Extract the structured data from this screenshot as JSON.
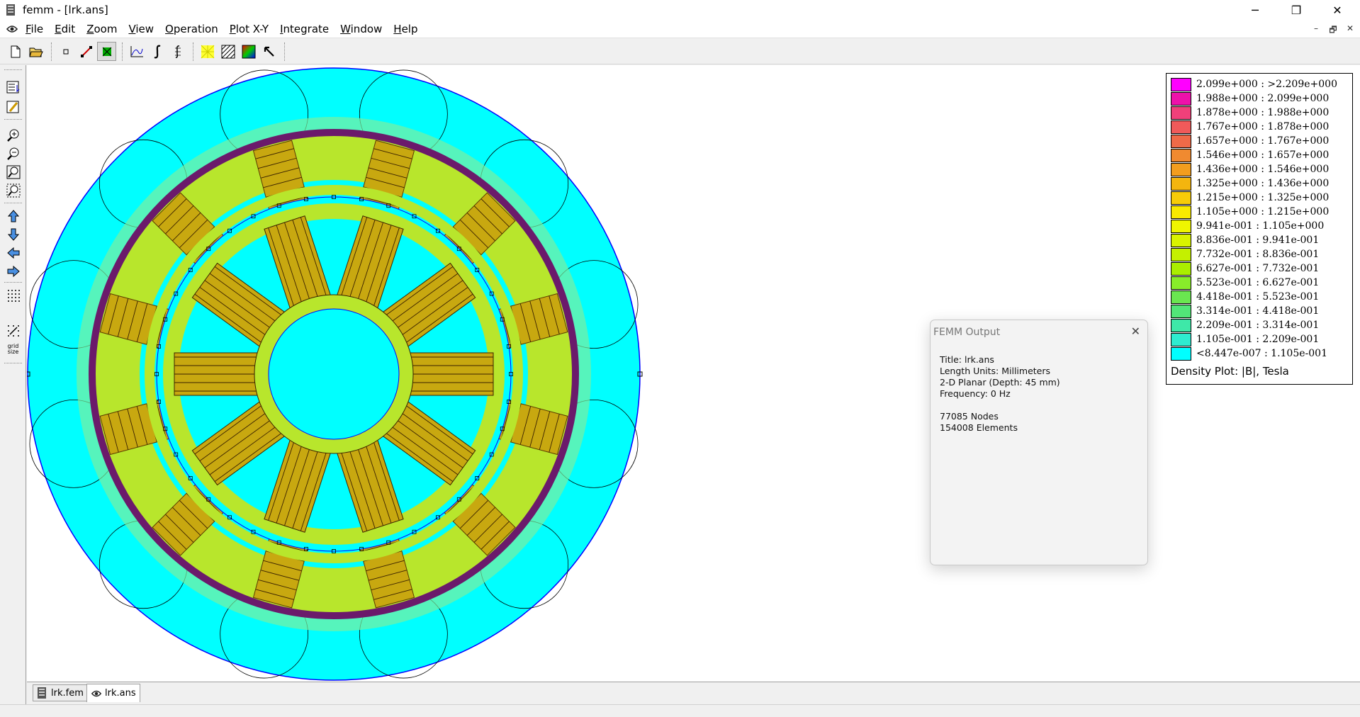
{
  "window": {
    "title": "femm - [lrk.ans]",
    "controls": {
      "minimize": "─",
      "maximize": "❐",
      "close": "✕"
    }
  },
  "menu": {
    "items": [
      {
        "label": "File",
        "u": "F",
        "rest": "ile"
      },
      {
        "label": "Edit",
        "u": "E",
        "rest": "dit"
      },
      {
        "label": "Zoom",
        "u": "Z",
        "rest": "oom"
      },
      {
        "label": "View",
        "u": "V",
        "rest": "iew"
      },
      {
        "label": "Operation",
        "u": "O",
        "rest": "peration"
      },
      {
        "label": "Plot X-Y",
        "u": "P",
        "rest": "lot X-Y"
      },
      {
        "label": "Integrate",
        "u": "I",
        "rest": "ntegrate"
      },
      {
        "label": "Window",
        "u": "W",
        "rest": "indow"
      },
      {
        "label": "Help",
        "u": "H",
        "rest": "elp"
      }
    ],
    "mdi": {
      "minimize": "–",
      "restore": "🗗",
      "close": "✕"
    }
  },
  "toolbar": {
    "icons": [
      "new-file-icon",
      "open-folder-icon",
      "point-mode-icon",
      "contour-mode-icon",
      "area-mode-icon",
      "plot-xy-icon",
      "line-integral-icon",
      "block-integral-icon",
      "mesh-icon",
      "hatch-icon",
      "density-plot-icon",
      "select-arrow-icon"
    ]
  },
  "lefttoolbar": {
    "icons": [
      "show-results-icon",
      "edit-results-icon",
      "zoom-in-icon",
      "zoom-out-icon",
      "zoom-fit-icon",
      "zoom-window-icon",
      "pan-up-icon",
      "pan-down-icon",
      "pan-left-icon",
      "pan-right-icon",
      "show-grid-icon",
      "snap-grid-icon",
      "grid-size-icon"
    ],
    "grid_size_label": "grid size"
  },
  "colors": {
    "bar": [
      "#ff00ff",
      "#ee11aa",
      "#f0407a",
      "#f05a5a",
      "#f06a48",
      "#f08a30",
      "#f29d1e",
      "#f4b50e",
      "#f7cc08",
      "#f9ea00",
      "#eff500",
      "#d9f300",
      "#c4f000",
      "#aaee00",
      "#88ec2a",
      "#6ae650",
      "#52e678",
      "#3ee8a8",
      "#2eecd0",
      "#00ffff"
    ],
    "field_bg": "#00ffff",
    "steel": "#b8e62c"
  },
  "legend": {
    "rows": [
      "2.099e+000 : >2.209e+000",
      "1.988e+000 : 2.099e+000",
      "1.878e+000 : 1.988e+000",
      "1.767e+000 : 1.878e+000",
      "1.657e+000 : 1.767e+000",
      "1.546e+000 : 1.657e+000",
      "1.436e+000 : 1.546e+000",
      "1.325e+000 : 1.436e+000",
      "1.215e+000 : 1.325e+000",
      "1.105e+000 : 1.215e+000",
      "9.941e-001 : 1.105e+000",
      "8.836e-001 : 9.941e-001",
      "7.732e-001 : 8.836e-001",
      "6.627e-001 : 7.732e-001",
      "5.523e-001 : 6.627e-001",
      "4.418e-001 : 5.523e-001",
      "3.314e-001 : 4.418e-001",
      "2.209e-001 : 3.314e-001",
      "1.105e-001 : 2.209e-001",
      "<8.447e-007 : 1.105e-001"
    ],
    "title": "Density Plot: |B|, Tesla"
  },
  "output": {
    "title": "FEMM Output",
    "close": "✕",
    "line_title": "Title: lrk.ans",
    "line_units": "Length Units: Millimeters",
    "line_planar": "2-D Planar (Depth: 45 mm)",
    "line_freq": "Frequency: 0 Hz",
    "line_nodes": "77085 Nodes",
    "line_elements": "154008 Elements"
  },
  "tabs": [
    {
      "label": "lrk.fem"
    },
    {
      "label": "lrk.ans"
    }
  ]
}
